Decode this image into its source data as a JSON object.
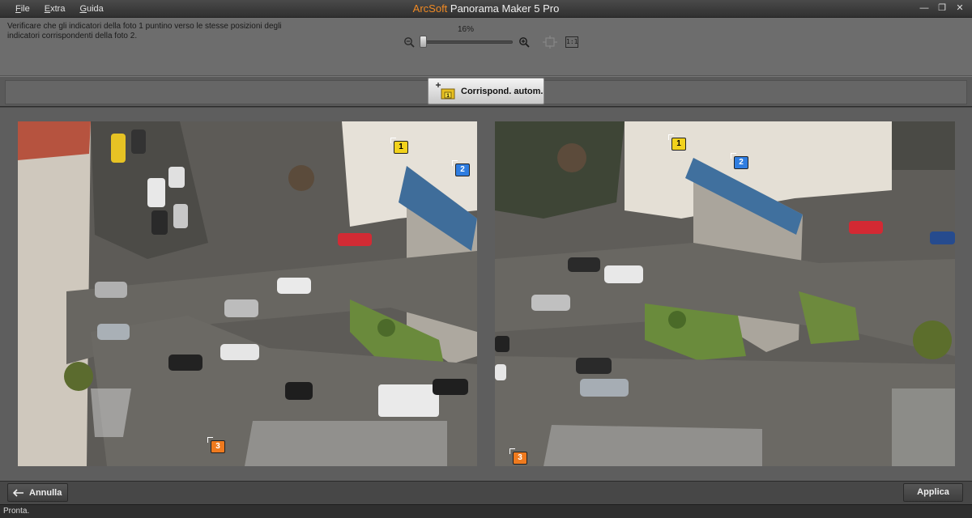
{
  "window": {
    "brand": "ArcSoft",
    "title": " Panorama Maker 5 Pro",
    "controls": {
      "minimize": "—",
      "restore": "❐",
      "close": "✕"
    }
  },
  "menu": [
    "File",
    "Extra",
    "Guida"
  ],
  "instruction": "Verificare che gli indicatori della foto 1 puntino verso le stesse posizioni degli indicatori corrispondenti della foto 2.",
  "zoom": {
    "label": "16%",
    "level": 0.0
  },
  "toolbar": {
    "actual_size": "1:1",
    "auto_match_label": "Corrispond. autom.",
    "auto_match_badge": "1"
  },
  "photos": {
    "left": {
      "markers": [
        {
          "label": "1",
          "color": "yellow"
        },
        {
          "label": "2",
          "color": "blue"
        },
        {
          "label": "3",
          "color": "orange"
        }
      ]
    },
    "right": {
      "markers": [
        {
          "label": "1",
          "color": "yellow"
        },
        {
          "label": "2",
          "color": "blue"
        },
        {
          "label": "3",
          "color": "orange"
        }
      ]
    }
  },
  "actions": {
    "cancel": "Annulla",
    "apply": "Applica"
  },
  "status": "Pronta.",
  "colors": {
    "brand": "#f08a24",
    "marker_yellow": "#f2d21c",
    "marker_blue": "#2f7de0",
    "marker_orange": "#ef7a1e"
  }
}
